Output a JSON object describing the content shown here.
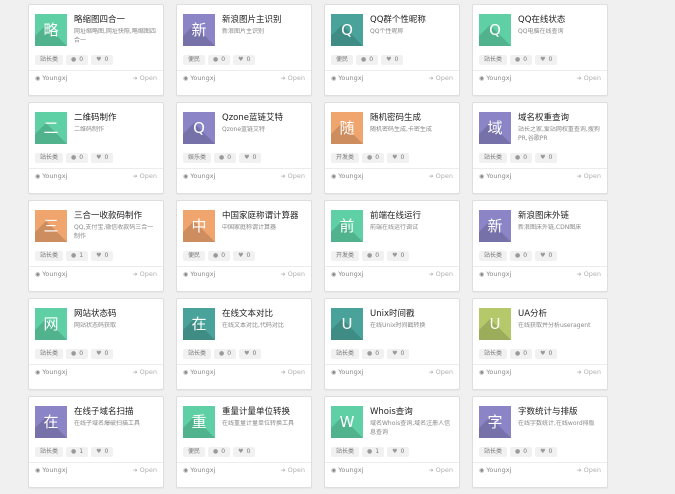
{
  "labels": {
    "author": "Youngxj",
    "open": "Open"
  },
  "cards": [
    {
      "glyph": "略",
      "color": "#5fd0a6",
      "title": "略缩图四合一",
      "desc": "网址缩略图,网址快照,略缩图四合一",
      "tag": "站长类",
      "views": "0",
      "likes": "0"
    },
    {
      "glyph": "新",
      "color": "#8b84c6",
      "title": "新浪图片主识别",
      "desc": "新浪图片主识别",
      "tag": "便民",
      "views": "0",
      "likes": "0"
    },
    {
      "glyph": "Q",
      "color": "#4aa39a",
      "title": "QQ群个性昵称",
      "desc": "QQ个性昵称",
      "tag": "便民",
      "views": "0",
      "likes": "0"
    },
    {
      "glyph": "Q",
      "color": "#5fd0a6",
      "title": "QQ在线状态",
      "desc": "QQ电脑在线查询",
      "tag": "站长类",
      "views": "0",
      "likes": "0"
    },
    {
      "glyph": "二",
      "color": "#5fd0a6",
      "title": "二维码制作",
      "desc": "二维码制作",
      "tag": "站长类",
      "views": "0",
      "likes": "0"
    },
    {
      "glyph": "Q",
      "color": "#8b84c6",
      "title": "Qzone蓝链艾特",
      "desc": "Qzone蓝链艾特",
      "tag": "娱乐类",
      "views": "0",
      "likes": "0"
    },
    {
      "glyph": "随",
      "color": "#f0a56e",
      "title": "随机密码生成",
      "desc": "随机密码生成,卡密生成",
      "tag": "开发类",
      "views": "0",
      "likes": "0"
    },
    {
      "glyph": "域",
      "color": "#8b84c6",
      "title": "域名权重查询",
      "desc": "站长之家,爱站网权重查询,搜狗PR,谷歌PR",
      "tag": "站长类",
      "views": "0",
      "likes": "0"
    },
    {
      "glyph": "三",
      "color": "#f0a56e",
      "title": "三合一收款码制作",
      "desc": "QQ,支付宝,微信收款码三合一制作",
      "tag": "站长类",
      "views": "1",
      "likes": "0"
    },
    {
      "glyph": "中",
      "color": "#f0a56e",
      "title": "中国家庭称谓计算器",
      "desc": "中国家庭称谓计算器",
      "tag": "便民",
      "views": "0",
      "likes": "0"
    },
    {
      "glyph": "前",
      "color": "#5fd0a6",
      "title": "前端在线运行",
      "desc": "前端在线运行调试",
      "tag": "开发类",
      "views": "0",
      "likes": "0"
    },
    {
      "glyph": "新",
      "color": "#8b84c6",
      "title": "新浪图床外链",
      "desc": "新浪图床外链,CDN图床",
      "tag": "站长类",
      "views": "0",
      "likes": "0"
    },
    {
      "glyph": "网",
      "color": "#5fd0a6",
      "title": "网站状态码",
      "desc": "网站状态码获取",
      "tag": "站长类",
      "views": "0",
      "likes": "0"
    },
    {
      "glyph": "在",
      "color": "#4aa39a",
      "title": "在线文本对比",
      "desc": "在线文本对比,代码对比",
      "tag": "站长类",
      "views": "0",
      "likes": "0"
    },
    {
      "glyph": "U",
      "color": "#4aa39a",
      "title": "Unix时间戳",
      "desc": "在线Unix时间戳转换",
      "tag": "站长类",
      "views": "0",
      "likes": "0"
    },
    {
      "glyph": "U",
      "color": "#b5c96a",
      "title": "UA分析",
      "desc": "在线获取并分析useragent",
      "tag": "站长类",
      "views": "0",
      "likes": "0"
    },
    {
      "glyph": "在",
      "color": "#8b84c6",
      "title": "在线子域名扫描",
      "desc": "在线子域名爆破扫描工具",
      "tag": "站长类",
      "views": "1",
      "likes": "0"
    },
    {
      "glyph": "重",
      "color": "#5fd0a6",
      "title": "重量计量单位转换",
      "desc": "在线重量计量单位转换工具",
      "tag": "便民",
      "views": "0",
      "likes": "0"
    },
    {
      "glyph": "W",
      "color": "#5fd0a6",
      "title": "Whois查询",
      "desc": "域名Whois查询,域名注册人信息查询",
      "tag": "站长类",
      "views": "1",
      "likes": "0"
    },
    {
      "glyph": "字",
      "color": "#8b84c6",
      "title": "字数统计与排版",
      "desc": "在线字数统计,在线word排版",
      "tag": "站长类",
      "views": "0",
      "likes": "0"
    }
  ]
}
